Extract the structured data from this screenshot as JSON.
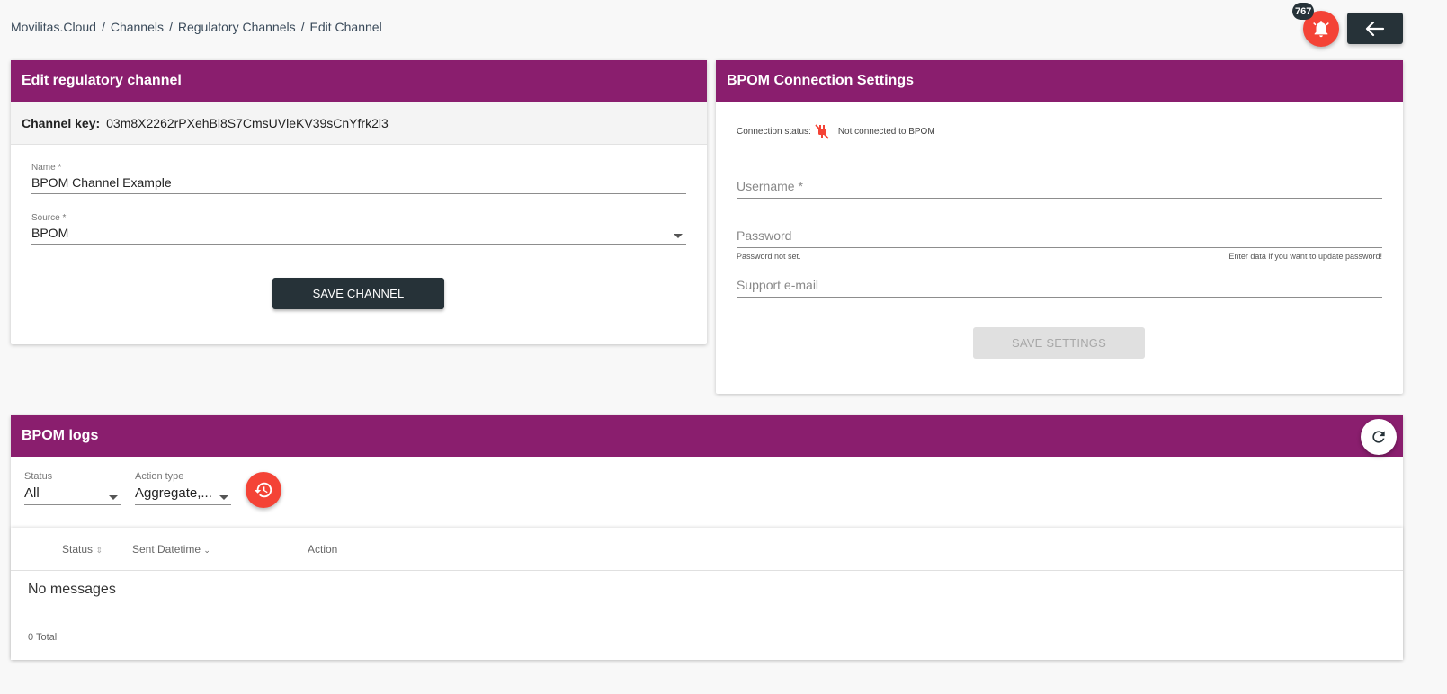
{
  "breadcrumb": {
    "items": [
      "Movilitas.Cloud",
      "Channels",
      "Regulatory Channels",
      "Edit Channel"
    ],
    "separator": "/"
  },
  "header_actions": {
    "notifications_count": "767",
    "notifications_icon": "bell-icon",
    "back_icon": "arrow-left-icon",
    "accent": "#f44336",
    "dark": "#263238"
  },
  "edit_channel": {
    "title": "Edit regulatory channel",
    "key_label": "Channel key:",
    "key_value": "03m8X2262rPXehBl8S7CmsUVleKV39sCnYfrk2l3",
    "name_label": "Name *",
    "name_value": "BPOM Channel Example",
    "source_label": "Source *",
    "source_value": "BPOM",
    "save_label": "SAVE CHANNEL",
    "header_color": "#8a1e6e"
  },
  "connection": {
    "title": "BPOM Connection Settings",
    "status_label": "Connection status:",
    "status_icon": "plug-disconnected-icon",
    "status_text": "Not connected to BPOM",
    "username_placeholder": "Username *",
    "password_placeholder": "Password",
    "password_hint_left": "Password not set.",
    "password_hint_right": "Enter data if you want to update password!",
    "support_email_placeholder": "Support e-mail",
    "save_label": "SAVE SETTINGS"
  },
  "logs": {
    "title": "BPOM logs",
    "refresh_icon": "refresh-icon",
    "status_filter_label": "Status",
    "status_filter_value": "All",
    "action_filter_label": "Action type",
    "action_filter_value": "Aggregate,...",
    "history_icon": "history-icon",
    "columns": [
      "Status",
      "Sent Datetime",
      "Action"
    ],
    "empty_text": "No messages",
    "total_text": "0 Total"
  }
}
